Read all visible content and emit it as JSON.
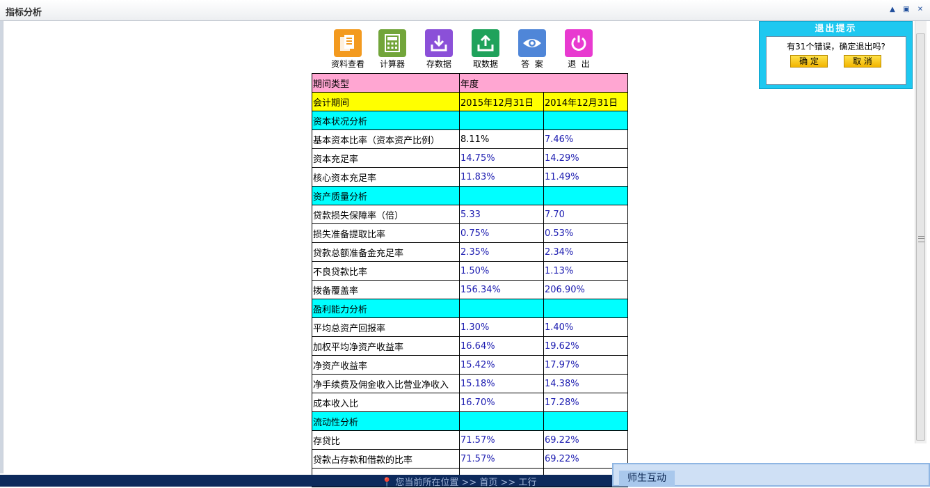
{
  "window": {
    "title": "指标分析"
  },
  "toolbar": [
    {
      "label": "资料查看",
      "icon": "documents-icon",
      "color": "#f39a1f"
    },
    {
      "label": "计算器",
      "icon": "calculator-icon",
      "color": "#72a53a"
    },
    {
      "label": "存数据",
      "icon": "save-download-icon",
      "color": "#8b50d8"
    },
    {
      "label": "取数据",
      "icon": "upload-icon",
      "color": "#1fa25b"
    },
    {
      "label": "答  案",
      "icon": "eye-icon",
      "color": "#4f86d8"
    },
    {
      "label": "退  出",
      "icon": "power-icon",
      "color": "#e83ad0"
    }
  ],
  "table": {
    "header": {
      "c1": "期间类型",
      "c2": "年度"
    },
    "period": {
      "c1": "会计期间",
      "c2": "2015年12月31日",
      "c3": "2014年12月31日"
    },
    "rows": [
      {
        "type": "section",
        "c1": "资本状况分析"
      },
      {
        "type": "data",
        "c1": "基本资本比率（资本资产比例）",
        "c2": "8.11%",
        "c3": "7.46%",
        "c2black": true
      },
      {
        "type": "data",
        "c1": "资本充足率",
        "c2": "14.75%",
        "c3": "14.29%"
      },
      {
        "type": "data",
        "c1": "核心资本充足率",
        "c2": "11.83%",
        "c3": "11.49%"
      },
      {
        "type": "section",
        "c1": "资产质量分析"
      },
      {
        "type": "data",
        "c1": "贷款损失保障率（倍）",
        "c2": "5.33",
        "c3": "7.70"
      },
      {
        "type": "data",
        "c1": "损失准备提取比率",
        "c2": "0.75%",
        "c3": "0.53%"
      },
      {
        "type": "data",
        "c1": "贷款总额准备金充足率",
        "c2": "2.35%",
        "c3": "2.34%"
      },
      {
        "type": "data",
        "c1": "不良贷款比率",
        "c2": "1.50%",
        "c3": "1.13%"
      },
      {
        "type": "data",
        "c1": "拨备覆盖率",
        "c2": "156.34%",
        "c3": "206.90%"
      },
      {
        "type": "section",
        "c1": "盈利能力分析"
      },
      {
        "type": "data",
        "c1": "平均总资产回报率",
        "c2": "1.30%",
        "c3": "1.40%"
      },
      {
        "type": "data",
        "c1": "加权平均净资产收益率",
        "c2": "16.64%",
        "c3": "19.62%"
      },
      {
        "type": "data",
        "c1": "净资产收益率",
        "c2": "15.42%",
        "c3": "17.97%"
      },
      {
        "type": "data",
        "c1": "净手续费及佣金收入比营业净收入",
        "c2": "15.18%",
        "c3": "14.38%"
      },
      {
        "type": "data",
        "c1": "成本收入比",
        "c2": "16.70%",
        "c3": "17.28%"
      },
      {
        "type": "section",
        "c1": "流动性分析"
      },
      {
        "type": "data",
        "c1": "存贷比",
        "c2": "71.57%",
        "c3": "69.22%"
      },
      {
        "type": "data",
        "c1": "贷款占存款和借款的比率",
        "c2": "71.57%",
        "c3": "69.22%"
      },
      {
        "type": "data",
        "c1": "",
        "c2": "",
        "c3": ""
      }
    ]
  },
  "dialog": {
    "title": "退出提示",
    "message": "有31个错误，确定退出吗?",
    "ok_label": "确 定",
    "cancel_label": "取 消"
  },
  "status": {
    "location": "您当前所在位置 >> 首页 >> 工行"
  },
  "chat": {
    "tab_label": "师生互动"
  },
  "colors": {
    "header_pink": "#ffa6d2",
    "period_yellow": "#ffff00",
    "section_cyan": "#00ffff",
    "value_blue": "#1b1bb0",
    "dialog_cyan": "#1ec8f0"
  }
}
